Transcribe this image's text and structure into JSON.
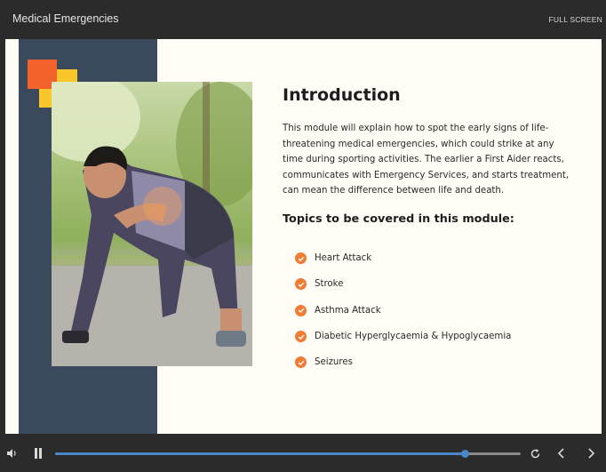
{
  "window": {
    "title": "Medical Emergencies",
    "fullscreen_label": "FULL SCREEN"
  },
  "slide": {
    "heading": "Introduction",
    "intro_text": "This module will explain how to spot the early signs of life-threatening medical emergencies, which could strike at any time during sporting activities. The earlier a First Aider reacts, communicates with Emergency Services, and starts treatment, can mean the difference between life and death.",
    "topics_heading": "Topics to be covered in this module:",
    "topics": [
      "Heart Attack",
      "Stroke",
      "Asthma Attack",
      "Diabetic Hyperglycaemia & Hypoglycaemia",
      "Seizures"
    ],
    "colors": {
      "navy_panel": "#3a4a5c",
      "accent_orange": "#f2622a",
      "accent_yellow": "#f9c72a",
      "check": "#f07c36"
    }
  },
  "player": {
    "progress_fraction": 0.88,
    "icons": [
      "volume-icon",
      "pause-icon",
      "replay-icon",
      "chevron-left-icon",
      "chevron-right-icon"
    ],
    "progress_color": "#4a86c8"
  }
}
